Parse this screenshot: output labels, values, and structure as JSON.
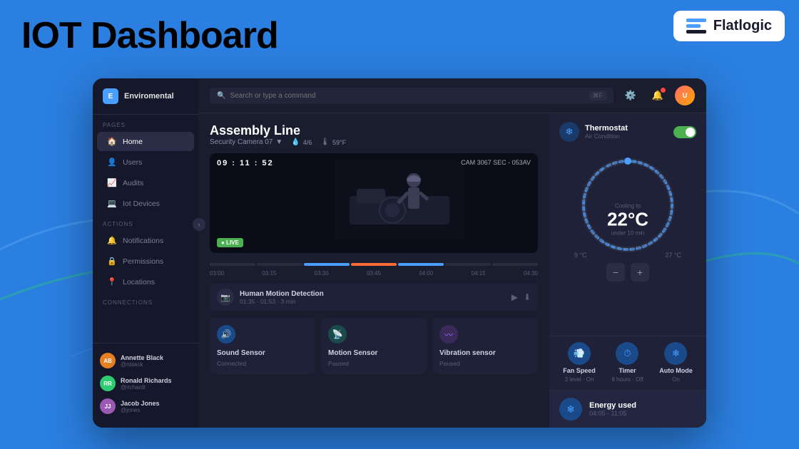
{
  "page": {
    "title": "IOT Dashboard",
    "logo": {
      "text": "Flatlogic"
    }
  },
  "sidebar": {
    "brand": "Enviromental",
    "nav_label": "PAGES",
    "items": [
      {
        "id": "home",
        "label": "Home",
        "icon": "🏠",
        "active": true
      },
      {
        "id": "users",
        "label": "Users",
        "icon": "👤"
      },
      {
        "id": "audits",
        "label": "Audits",
        "icon": "📈"
      },
      {
        "id": "iot-devices",
        "label": "Iot Devices",
        "icon": "💻"
      }
    ],
    "actions_label": "ACTIONS",
    "action_items": [
      {
        "id": "notifications",
        "label": "Notifications",
        "icon": "🔔"
      },
      {
        "id": "permissions",
        "label": "Permissions",
        "icon": "🔒"
      },
      {
        "id": "locations",
        "label": "Locations",
        "icon": "📍"
      }
    ],
    "connections_label": "CONNECTIONS",
    "users": [
      {
        "name": "Annette Black",
        "handle": "@nblack",
        "color": "#e67e22"
      },
      {
        "name": "Ronald Richards",
        "handle": "@richardt",
        "color": "#2ecc71"
      },
      {
        "name": "Jacob Jones",
        "handle": "@jones",
        "color": "#9b59b6"
      }
    ]
  },
  "topbar": {
    "search_placeholder": "Search or type a command",
    "shortcut": "⌘F"
  },
  "assembly": {
    "title": "Assembly Line",
    "camera": "Security Camera 07",
    "timestamp": "09 : 11 : 52",
    "cam_id": "CAM 3067 SEC - 053AV",
    "meta": [
      {
        "icon": "💧",
        "value": "4/6"
      },
      {
        "icon": "🌡",
        "value": "59°F"
      }
    ],
    "live_label": "● LIVE",
    "alert": {
      "title": "Human Motion Detection",
      "time": "01:35 - 01:53  · 3 min"
    },
    "timeline_labels": [
      "03:00",
      "03:15",
      "03:30",
      "03:45",
      "04:00",
      "04:15",
      "04:30"
    ]
  },
  "sensors": [
    {
      "id": "sound",
      "name": "Sound Sensor",
      "status": "Connected",
      "icon": "🔊",
      "color": "blue"
    },
    {
      "id": "motion",
      "name": "Motion Sensor",
      "status": "Paused",
      "icon": "📡",
      "color": "teal"
    },
    {
      "id": "vibration",
      "name": "Vibration sensor",
      "status": "Paused",
      "icon": "〰",
      "color": "purple"
    }
  ],
  "thermostat": {
    "title": "Thermostat",
    "subtitle": "Air Condition",
    "enabled": true,
    "cooling_label": "Cooling to",
    "temp": "22°C",
    "under_label": "under 10 min",
    "min_temp": "9 °C",
    "max_temp": "27 °C"
  },
  "controls": [
    {
      "id": "fan",
      "name": "Fan Speed",
      "value": "3 level · On",
      "icon": "💨"
    },
    {
      "id": "timer",
      "name": "Timer",
      "value": "8 hours · Off",
      "icon": "⏱"
    },
    {
      "id": "auto",
      "name": "Auto Mode",
      "value": "On",
      "icon": "❄"
    }
  ],
  "energy": {
    "title": "Energy used",
    "time": "04:05 - 11:05"
  }
}
